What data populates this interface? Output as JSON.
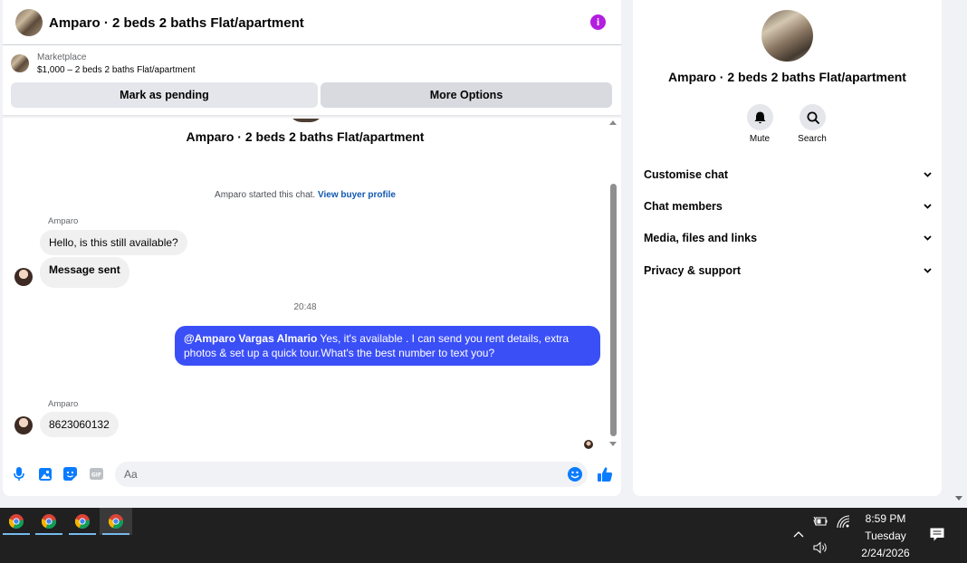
{
  "header": {
    "title": "Amparo · 2 beds 2 baths Flat/apartment",
    "info_icon": "info-icon",
    "info_color": "#b31ee0"
  },
  "marketplace": {
    "label": "Marketplace",
    "price_line": "$1,000 – 2 beds 2 baths Flat/apartment",
    "pending_label": "Mark as pending",
    "more_label": "More Options"
  },
  "thread": {
    "title": "Amparo · 2 beds 2 baths Flat/apartment",
    "started_text": "Amparo started this chat.",
    "profile_link": "View buyer profile",
    "sender_1": "Amparo",
    "msg_1": "Hello, is this still available?",
    "msg_2": "Message sent",
    "timestamp": "20:48",
    "out_mention": "@Amparo Vargas Almario",
    "out_text": " Yes, it's available .  I can send you rent details, extra photos & set up a quick tour.What's the best number to text you?",
    "sender_2": "Amparo",
    "msg_3": "8623060132",
    "outgoing_color": "#3b4ff7"
  },
  "composer": {
    "placeholder": "Aa",
    "accent": "#0a7cff"
  },
  "info_panel": {
    "title": "Amparo · 2 beds 2 baths Flat/apartment",
    "mute_label": "Mute",
    "search_label": "Search",
    "sections": [
      "Customise chat",
      "Chat members",
      "Media, files and links",
      "Privacy & support"
    ]
  },
  "taskbar": {
    "apps": [
      "chrome-icon",
      "chrome-icon",
      "chrome-icon",
      "chrome-icon"
    ],
    "time": "8:59 PM",
    "day": "Tuesday",
    "date": "2/24/2026"
  }
}
